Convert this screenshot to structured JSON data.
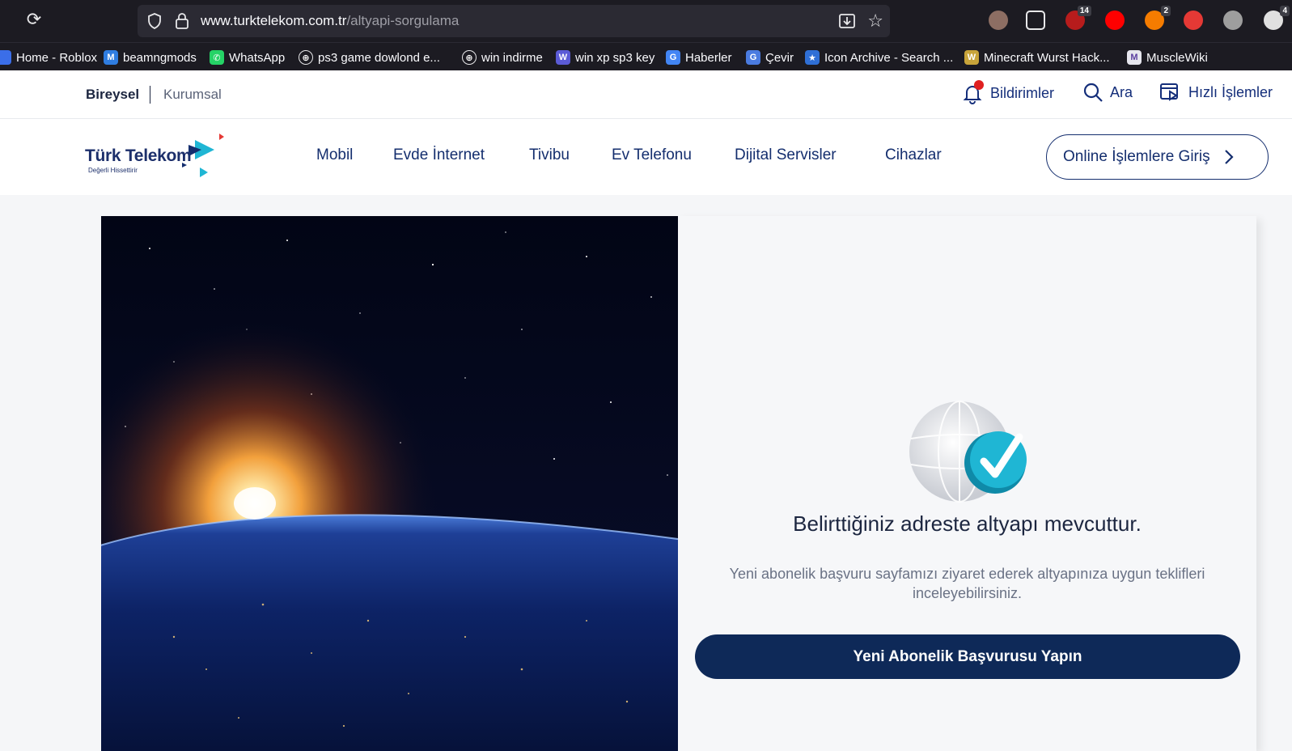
{
  "browser": {
    "url_host": "www.turktelekom.com.tr",
    "url_path": "/altyapi-sorgulama",
    "extensions": [
      {
        "icon": "cookie-icon",
        "color": "#8d6e63",
        "badge": ""
      },
      {
        "icon": "puzzle-icon",
        "color": "#1c1b22",
        "badge": ""
      },
      {
        "icon": "ublock-icon",
        "color": "#b71c1c",
        "badge": "14"
      },
      {
        "icon": "youtube-icon",
        "color": "#ff0000",
        "badge": ""
      },
      {
        "icon": "rocket-icon",
        "color": "#f57c00",
        "badge": "2"
      },
      {
        "icon": "pwa-icon",
        "color": "#e53935",
        "badge": ""
      },
      {
        "icon": "cube-icon",
        "color": "#9e9e9e",
        "badge": ""
      },
      {
        "icon": "account-icon",
        "color": "#e0e0e0",
        "badge": "4"
      }
    ],
    "bookmarks": [
      {
        "label": "Home - Roblox",
        "icon_color": "#3b6ee8",
        "glyph": ""
      },
      {
        "label": "beamngmods",
        "icon_color": "#2f7de1",
        "glyph": "M"
      },
      {
        "label": "WhatsApp",
        "icon_color": "#25d366",
        "glyph": "✆"
      },
      {
        "label": "ps3 game dowlond e...",
        "icon_color": "#1c1b22",
        "glyph": "⊕"
      },
      {
        "label": "win indirme",
        "icon_color": "#1c1b22",
        "glyph": "⊕"
      },
      {
        "label": "win xp sp3 key",
        "icon_color": "#5b5bd6",
        "glyph": "W"
      },
      {
        "label": "Haberler",
        "icon_color": "#4285f4",
        "glyph": "G"
      },
      {
        "label": "Çevir",
        "icon_color": "#4a7be0",
        "glyph": "G"
      },
      {
        "label": "Icon Archive - Search ...",
        "icon_color": "#2f6fd6",
        "glyph": "★"
      },
      {
        "label": "Minecraft Wurst Hack...",
        "icon_color": "#c8a43a",
        "glyph": "W"
      },
      {
        "label": "MuscleWiki",
        "icon_color": "#e6e6ee",
        "glyph": "M"
      }
    ]
  },
  "topbar": {
    "segment_active": "Bireysel",
    "segment_other": "Kurumsal",
    "notifications_label": "Bildirimler",
    "search_label": "Ara",
    "quick_actions_label": "Hızlı İşlemler"
  },
  "nav": {
    "brand": "Türk Telekom",
    "tagline": "Değerli Hissettirir",
    "items": [
      "Mobil",
      "Evde İnternet",
      "Tivibu",
      "Ev Telefonu",
      "Dijital Servisler",
      "Cihazlar"
    ],
    "login_label": "Online İşlemlere Giriş"
  },
  "result": {
    "title": "Belirttiğiniz adreste altyapı mevcuttur.",
    "subtitle": "Yeni abonelik başvuru sayfamızı ziyaret ederek altyapınıza uygun teklifleri inceleyebilirsiniz.",
    "cta_label": "Yeni Abonelik Başvurusu Yapın"
  },
  "colors": {
    "brand_navy": "#0e2958",
    "nav_text": "#142e6e",
    "accent_teal": "#1fb6d4"
  }
}
